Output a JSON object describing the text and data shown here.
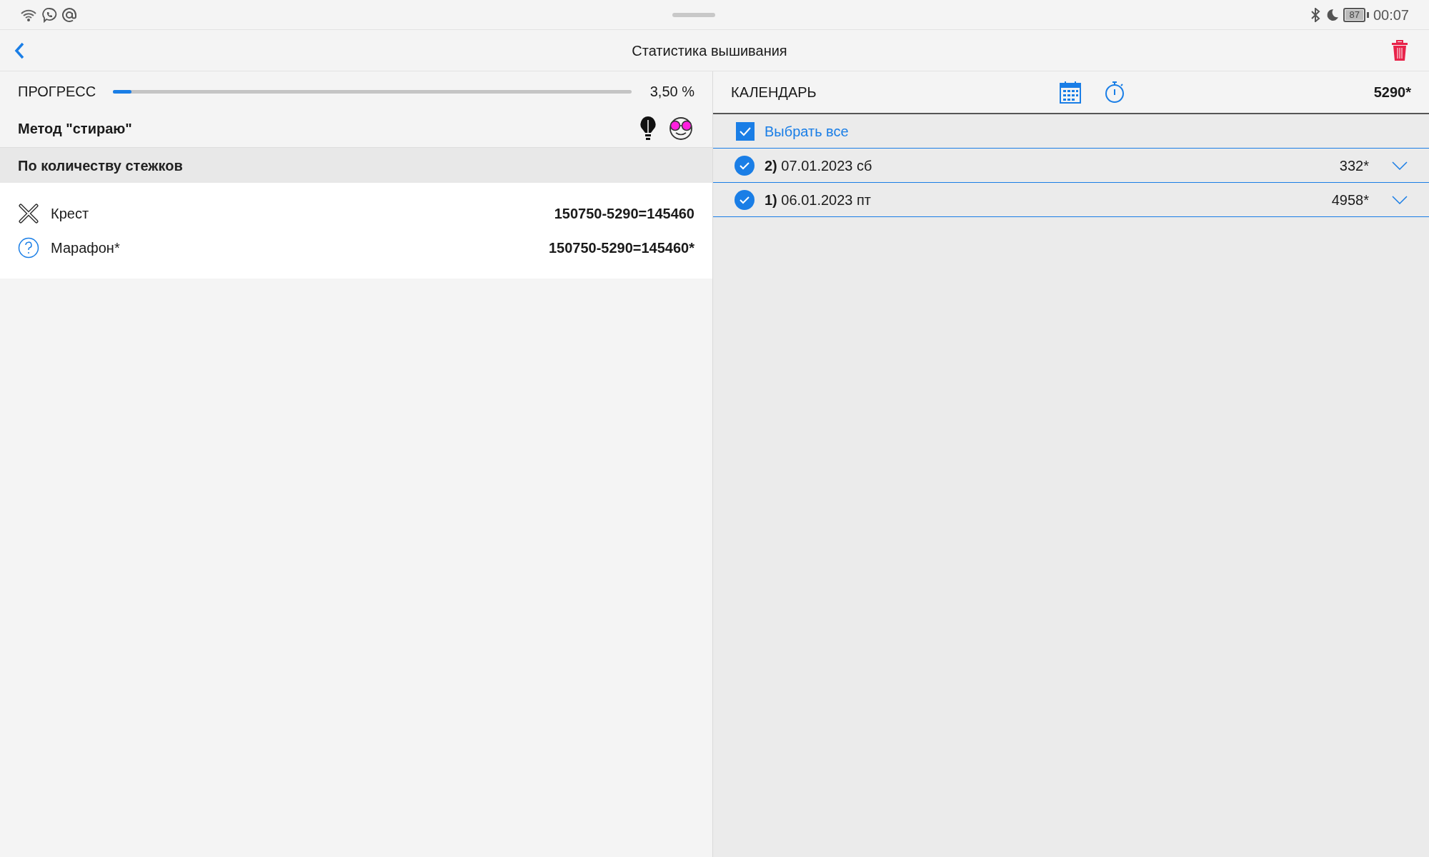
{
  "status_bar": {
    "battery": "87",
    "time": "00:07"
  },
  "header": {
    "title": "Статистика вышивания"
  },
  "progress": {
    "label": "ПРОГРЕСС",
    "level": 0.035,
    "reading": "3,50 %"
  },
  "method": {
    "label": "Метод \"стираю\""
  },
  "section": {
    "title": "По количеству стежков"
  },
  "stitches": [
    {
      "kind": "cross",
      "name": "Крест",
      "value": "150750-5290=145460"
    },
    {
      "kind": "unknown",
      "name": "Марафон*",
      "value": "150750-5290=145460*"
    }
  ],
  "calendar": {
    "title": "КАЛЕНДАРЬ",
    "total": "5290*",
    "select_all": {
      "label": "Выбрать все",
      "checked": true
    },
    "days": [
      {
        "label": "**2)** 07.01.2023 сб",
        "count": "332*",
        "checked": true
      },
      {
        "label": "**1)** 06.01.2023 пт",
        "count": "4958*",
        "checked": true
      }
    ]
  }
}
